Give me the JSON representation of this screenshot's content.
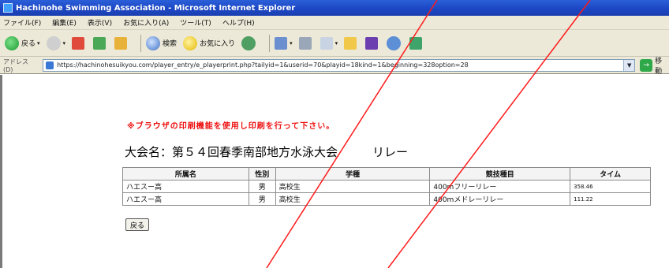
{
  "window": {
    "title": "Hachinohe Swimming Association - Microsoft Internet Explorer"
  },
  "menu": [
    "ファイル(F)",
    "編集(E)",
    "表示(V)",
    "お気に入り(A)",
    "ツール(T)",
    "ヘルプ(H)"
  ],
  "toolbar": {
    "back_label": "戻る",
    "search_label": "検索",
    "favorites_label": "お気に入り"
  },
  "address": {
    "label": "アドレス(D)",
    "url": "https://hachinohesuikyou.com/player_entry/e_playerprint.php?tailyid=1&userid=70&playid=18kind=1&beginning=328option=28",
    "go_label": "移動"
  },
  "page": {
    "notice": "※ブラウザの印刷機能を使用し印刷を行って下さい。",
    "title": "大会名：第５４回春季南部地方水泳大会",
    "relay": "リレー",
    "table": {
      "headers": [
        "所属名",
        "性別",
        "学種",
        "競技種目",
        "タイム"
      ],
      "rows": [
        [
          "ハエスー高",
          "男",
          "高校生",
          "400mフリーリレー",
          "358.46"
        ],
        [
          "ハエスー高",
          "男",
          "高校生",
          "400mメドレーリレー",
          "111.22"
        ]
      ]
    },
    "back_button": "戻る"
  },
  "colors": {
    "titlebar": "#1d47c4",
    "notice": "#ee1111",
    "overlay_line": "#ff0000"
  }
}
